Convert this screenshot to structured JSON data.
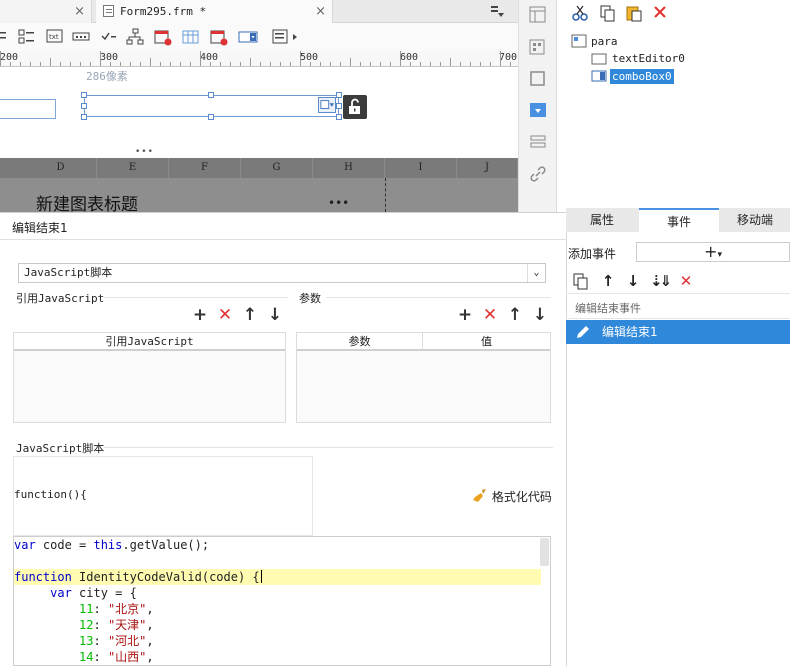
{
  "tabs": [
    {
      "title": "",
      "active": false
    },
    {
      "title": "Form295.frm *",
      "active": true
    }
  ],
  "ruler": {
    "labels": [
      "200",
      "300",
      "400",
      "500",
      "600",
      "700"
    ]
  },
  "canvas": {
    "size_hint": "286像素"
  },
  "sheet": {
    "columns": [
      "D",
      "E",
      "F",
      "G",
      "H",
      "I",
      "J"
    ],
    "chart_title": "新建图表标题"
  },
  "tree": {
    "root": "para",
    "children": [
      "textEditor0",
      "comboBox0"
    ],
    "selected": "comboBox0"
  },
  "editor": {
    "header": "编辑结束1",
    "script_type": "JavaScript脚本",
    "ref_js_label": "引用JavaScript",
    "params_label": "参数",
    "ref_js_col": "引用JavaScript",
    "params_cols": [
      "参数",
      "值"
    ],
    "js_script_label": "JavaScript脚本",
    "function_sig": "function(){",
    "format_button": "格式化代码"
  },
  "code_lines": [
    {
      "parts": [
        {
          "t": "var",
          "c": "kw"
        },
        {
          "t": " code = "
        },
        {
          "t": "this",
          "c": "kw"
        },
        {
          "t": ".getValue();"
        }
      ]
    },
    {
      "parts": []
    },
    {
      "parts": [
        {
          "t": "function",
          "c": "kw"
        },
        {
          "t": " IdentityCodeValid(code) {"
        }
      ],
      "highlight": true
    },
    {
      "parts": [
        {
          "t": "     "
        },
        {
          "t": "var",
          "c": "kw"
        },
        {
          "t": " city = {"
        }
      ]
    },
    {
      "parts": [
        {
          "t": "         "
        },
        {
          "t": "11",
          "c": "num"
        },
        {
          "t": ": "
        },
        {
          "t": "\"北京\"",
          "c": "str"
        },
        {
          "t": ","
        }
      ]
    },
    {
      "parts": [
        {
          "t": "         "
        },
        {
          "t": "12",
          "c": "num"
        },
        {
          "t": ": "
        },
        {
          "t": "\"天津\"",
          "c": "str"
        },
        {
          "t": ","
        }
      ]
    },
    {
      "parts": [
        {
          "t": "         "
        },
        {
          "t": "13",
          "c": "num"
        },
        {
          "t": ": "
        },
        {
          "t": "\"河北\"",
          "c": "str"
        },
        {
          "t": ","
        }
      ]
    },
    {
      "parts": [
        {
          "t": "         "
        },
        {
          "t": "14",
          "c": "num"
        },
        {
          "t": ": "
        },
        {
          "t": "\"山西\"",
          "c": "str"
        },
        {
          "t": ","
        }
      ]
    }
  ],
  "events_panel": {
    "tabs": [
      "属性",
      "事件",
      "移动端"
    ],
    "active_tab": "事件",
    "add_event_label": "添加事件",
    "add_symbol": "+",
    "section_header": "编辑结束事件",
    "item": "编辑结束1"
  },
  "colors": {
    "accent": "#2f88d9",
    "red": "#e23232",
    "selection_outline": "#6d9bd6"
  }
}
